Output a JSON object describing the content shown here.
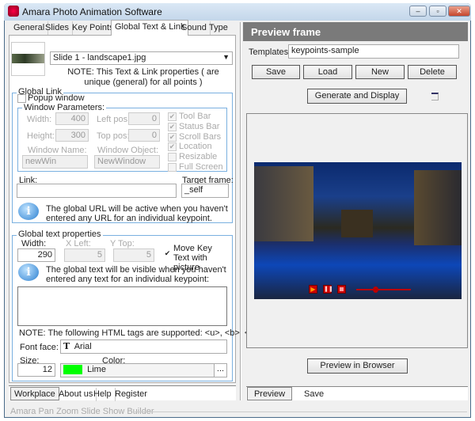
{
  "window": {
    "title": "Amara Photo Animation Software"
  },
  "tabs": [
    "General",
    "Slides",
    "Key Points",
    "Global Text & Link",
    "Sound",
    "Type"
  ],
  "slide_select": {
    "value": "Slide 1 - landscape1.jpg"
  },
  "note_unique": "NOTE: This Text & Link properties ( are unique (general) for all points )",
  "global_link": {
    "title": "Global Link",
    "popup_label": "Popup window",
    "popup_checked": false,
    "params_title": "Window Parameters:",
    "width_label": "Width:",
    "width": "400",
    "height_label": "Height:",
    "height": "300",
    "left_label": "Left pos:",
    "left": "0",
    "top_label": "Top pos:",
    "top": "0",
    "name_label": "Window Name:",
    "name": "newWin",
    "object_label": "Window Object:",
    "object": "NewWindow",
    "options": [
      {
        "label": "Tool Bar",
        "checked": true
      },
      {
        "label": "Status Bar",
        "checked": true
      },
      {
        "label": "Scroll Bars",
        "checked": true
      },
      {
        "label": "Location",
        "checked": true
      },
      {
        "label": "Resizable",
        "checked": false
      },
      {
        "label": "Full Screen",
        "checked": false
      }
    ],
    "link_label": "Link:",
    "link": "",
    "target_label": "Target frame:",
    "target": "_self",
    "info": "The global URL will be active when you haven't entered any URL for an individual keypoint."
  },
  "global_text": {
    "title": "Global text properties",
    "width_label": "Width:",
    "width": "290",
    "xleft_label": "X Left:",
    "xleft": "5",
    "ytop_label": "Y Top:",
    "ytop": "5",
    "move_label": "Move Key Text with picture",
    "move_checked": true,
    "info": "The global text will be visible when you haven't entered any text for an individual keypoint:",
    "text": "",
    "note": "NOTE: The following HTML tags are supported: <u>, <b>, <i>",
    "font_label": "Font face:",
    "font": "Arial",
    "size_label": "Size:",
    "size": "12",
    "color_label": "Color:",
    "color_name": "Lime",
    "color_hex": "#00ff00",
    "more": "..."
  },
  "bottom_tabs": [
    "Workplace",
    "About us",
    "Help",
    "Register"
  ],
  "status": "Amara Pan Zoom Slide Show Builder",
  "preview": {
    "title": "Preview frame",
    "templates_label": "Templates:",
    "template": "keypoints-sample",
    "buttons": [
      "Save",
      "Load",
      "New",
      "Delete"
    ],
    "generate": "Generate and Display",
    "browser": "Preview in Browser",
    "tabs": [
      "Preview",
      "Save"
    ],
    "slider_position": 0.35
  }
}
